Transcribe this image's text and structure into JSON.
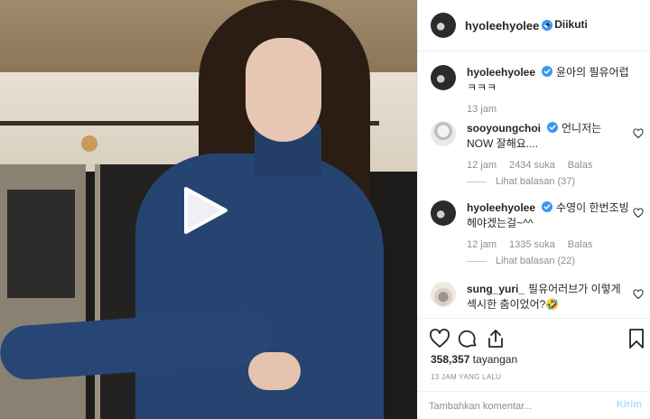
{
  "media": {
    "play_icon": "play-icon"
  },
  "header": {
    "username": "hyoleehyolee",
    "verified_icon": "verified-badge-icon",
    "separator": "•",
    "follow_status": "Diikuti"
  },
  "caption": {
    "username": "hyoleehyolee",
    "text": "윤아의 필유어럽 ㅋㅋㅋ",
    "time": "13 jam"
  },
  "comments": [
    {
      "username": "sooyoungchoi",
      "text": "언니저는 NOW 잘해요....",
      "time": "12 jam",
      "likes": "2434 suka",
      "reply_label": "Balas",
      "replies_label": "Lihat balasan (37)"
    },
    {
      "username": "hyoleehyolee",
      "text": "수영이 한번조빙 헤야겠는걸~^^",
      "time": "12 jam",
      "likes": "1335 suka",
      "reply_label": "Balas",
      "replies_label": "Lihat balasan (22)"
    },
    {
      "username": "sung_yuri_",
      "text": "필유어러브가 이렇게 섹시한 춤이었어?🤣"
    }
  ],
  "actions": {
    "like_icon": "heart-icon",
    "comment_icon": "comment-icon",
    "share_icon": "share-icon",
    "save_icon": "bookmark-icon"
  },
  "stats": {
    "views_count": "358,357",
    "views_label": "tayangan",
    "posted_ago": "13 JAM YANG LALU"
  },
  "add_comment": {
    "placeholder": "Tambahkan komentar...",
    "post_label": "Kirim"
  },
  "colors": {
    "verified": "#3897f0",
    "post_button_disabled": "#b2dffc",
    "secondary_text": "#8e8e8e",
    "divider": "#efefef"
  }
}
